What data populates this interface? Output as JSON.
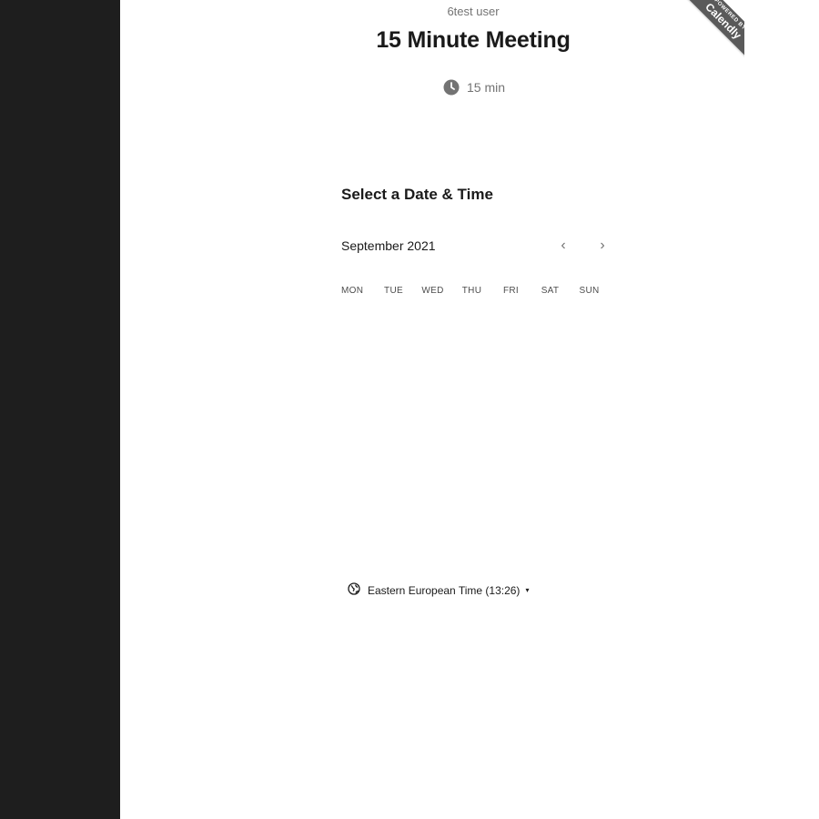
{
  "event": {
    "owner_name": "6test user",
    "title": "15 Minute Meeting",
    "duration": "15 min"
  },
  "badge": {
    "line1": "POWERED BY",
    "line2": "Calendly"
  },
  "scheduler": {
    "section_title": "Select a Date & Time",
    "month": "September 2021",
    "prev_icon": "chevron-left-icon",
    "next_icon": "chevron-right-icon",
    "prev_glyph": "‹",
    "next_glyph": "›",
    "weekdays": [
      "MON",
      "TUE",
      "WED",
      "THU",
      "FRI",
      "SAT",
      "SUN"
    ]
  },
  "timezone": {
    "label": "Eastern European Time (13:26)",
    "icon": "globe-icon",
    "caret": "▾"
  },
  "colors": {
    "left_panel": "#1e1e1e",
    "badge": "#5a5a5a",
    "muted_text": "#737373"
  }
}
